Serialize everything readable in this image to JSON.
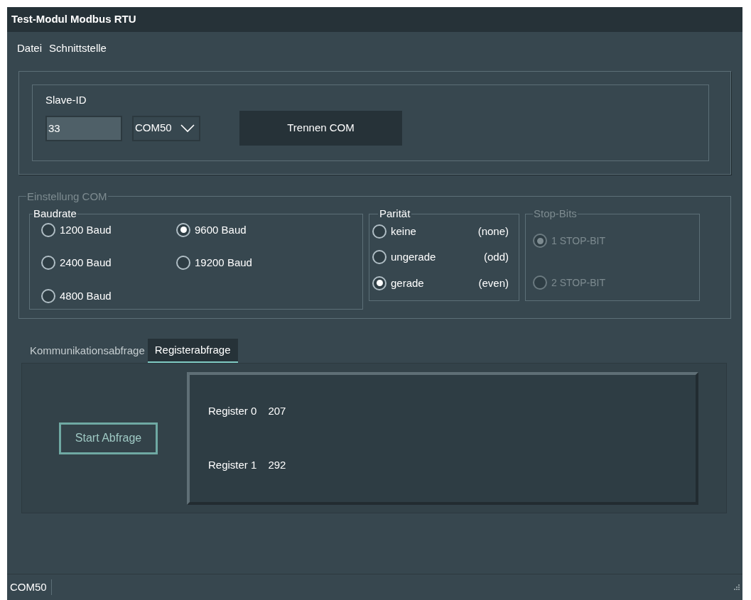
{
  "window": {
    "title": "Test-Modul Modbus RTU"
  },
  "menu": [
    "Datei",
    "Schnittstelle"
  ],
  "connection": {
    "slave_id_label": "Slave-ID",
    "slave_id": "33",
    "port": "COM50",
    "button": "Trennen COM"
  },
  "settings": {
    "title": "Einstellung COM",
    "baudrate": {
      "title": "Baudrate",
      "options": [
        {
          "label": "1200 Baud",
          "selected": false
        },
        {
          "label": "9600 Baud",
          "selected": true
        },
        {
          "label": "2400 Baud",
          "selected": false
        },
        {
          "label": "19200 Baud",
          "selected": false
        },
        {
          "label": "4800 Baud",
          "selected": false
        }
      ]
    },
    "parity": {
      "title": "Parität",
      "options": [
        {
          "label": "keine",
          "hint": "(none)",
          "selected": false
        },
        {
          "label": "ungerade",
          "hint": "(odd)",
          "selected": false
        },
        {
          "label": "gerade",
          "hint": "(even)",
          "selected": true
        }
      ]
    },
    "stop_bits": {
      "title": "Stop-Bits",
      "disabled": true,
      "options": [
        {
          "label": "1 STOP-BIT",
          "selected": true
        },
        {
          "label": "2 STOP-BIT",
          "selected": false
        }
      ]
    }
  },
  "tabs": [
    {
      "label": "Kommunikationsabfrage",
      "selected": false
    },
    {
      "label": "Registerabfrage",
      "selected": true
    }
  ],
  "query": {
    "button": "Start Abfrage",
    "registers": [
      {
        "name": "Register 0",
        "value": "207"
      },
      {
        "name": "Register 1",
        "value": "292"
      }
    ]
  },
  "status_bar": {
    "port": "COM50"
  }
}
